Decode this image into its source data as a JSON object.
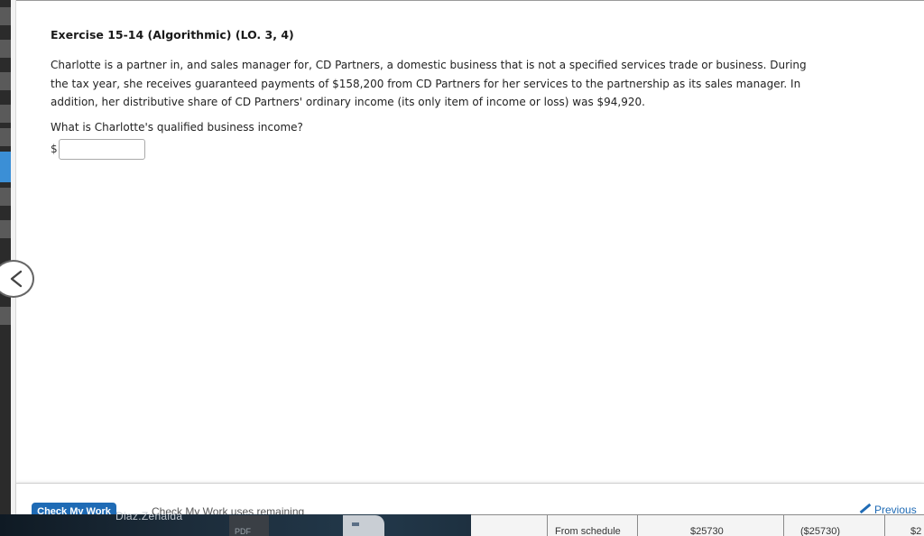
{
  "exercise": {
    "title": "Exercise 15-14 (Algorithmic) (LO. 3, 4)",
    "problem_text": "Charlotte is a partner in, and sales manager for, CD Partners, a domestic business that is not a specified services trade or business. During the tax year, she receives guaranteed payments of $158,200 from CD Partners for her services to the partnership as its sales manager. In addition, her distributive share of CD Partners' ordinary income (its only item of income or loss) was $94,920.",
    "question": "What is Charlotte's qualified business income?",
    "currency_symbol": "$",
    "answer_value": ""
  },
  "footer": {
    "check_button_label": "Check My Work",
    "ghost_text": "Check My Work uses remaining",
    "previous_label": "Previous"
  },
  "overlay": {
    "user_label": "Diaz.Zenaida",
    "pdf_label": "PDF",
    "sheet_cells": [
      "From schedule",
      "$25730",
      "($25730)",
      "$2"
    ]
  },
  "icons": {
    "nav_prev": "chevron-left-icon",
    "previous": "pencil-icon"
  },
  "colors": {
    "accent": "#1f6bb5",
    "active_tab": "#3b8fd6"
  }
}
